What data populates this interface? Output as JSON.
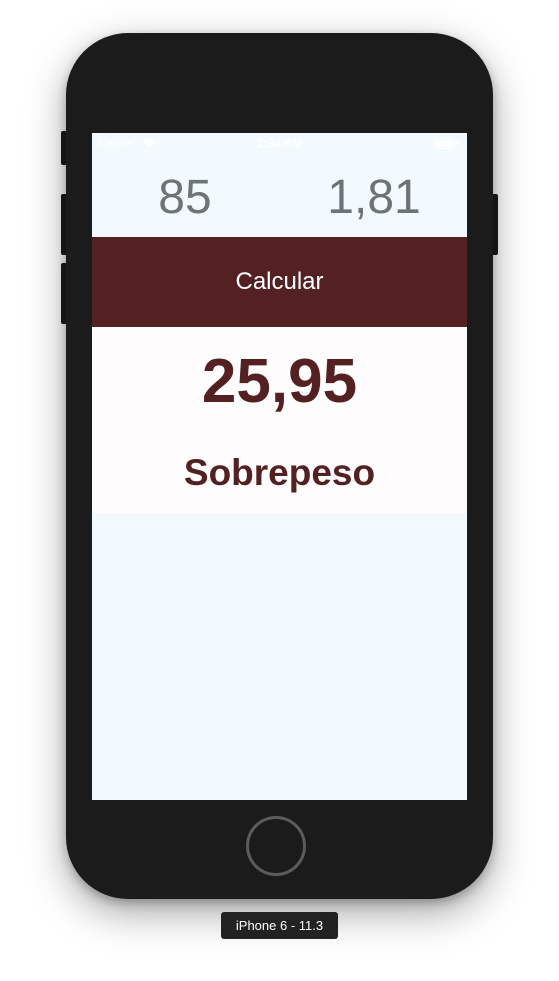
{
  "status_bar": {
    "carrier": "Carrier",
    "time": "1:34 PM"
  },
  "inputs": {
    "weight_value": "85",
    "height_value": "1,81"
  },
  "calculate_button": {
    "label": "Calcular"
  },
  "result": {
    "value": "25,95",
    "classification": "Sobrepeso"
  },
  "simulator": {
    "device_label": "iPhone 6 - 11.3"
  },
  "colors": {
    "accent": "#542123",
    "screen_background": "#f3faff",
    "input_text": "#6e7377",
    "device_body": "#1b1b1b"
  },
  "icons": {
    "wifi": "wifi-icon",
    "battery": "battery-icon"
  }
}
